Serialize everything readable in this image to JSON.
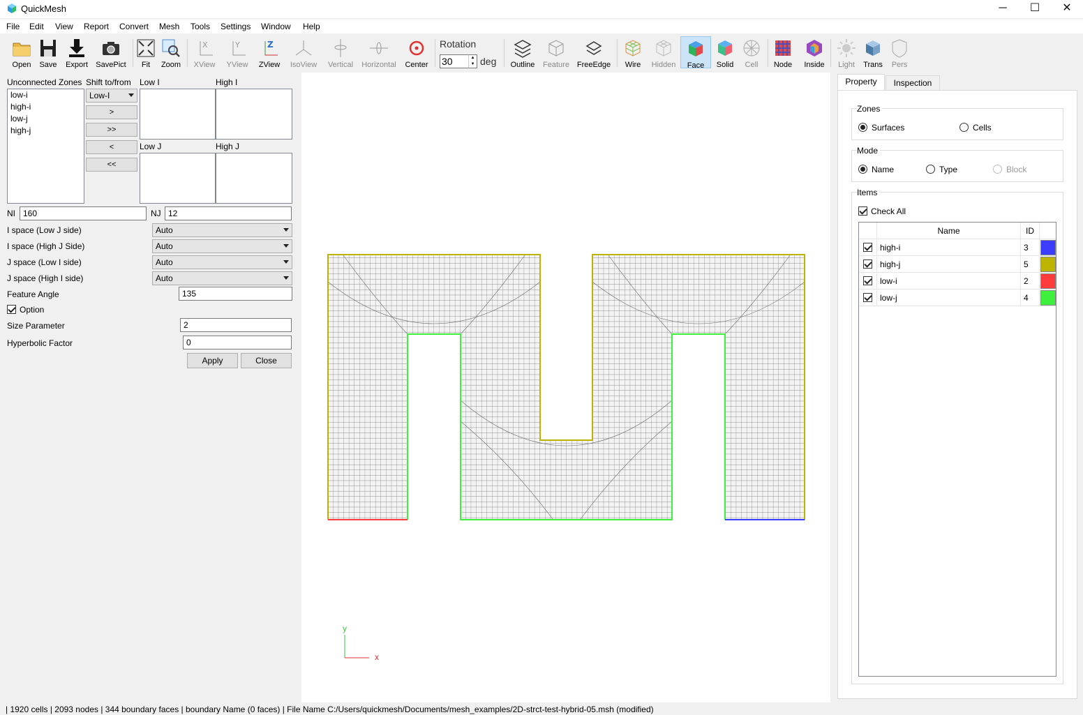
{
  "window": {
    "title": "QuickMesh",
    "minimize": "─",
    "maximize": "☐",
    "close": "✕"
  },
  "menu": [
    "File",
    "Edit",
    "View",
    "Report",
    "Convert",
    "Mesh",
    "Tools",
    "Settings",
    "Window",
    "Help"
  ],
  "toolbar": {
    "open": "Open",
    "save": "Save",
    "export": "Export",
    "savepict": "SavePict",
    "fit": "Fit",
    "zoom": "Zoom",
    "xview": "XView",
    "yview": "YView",
    "zview": "ZView",
    "isoview": "IsoView",
    "vertical": "Vertical",
    "horizontal": "Horizontal",
    "center": "Center",
    "rotation_label": "Rotation",
    "rotation_value": "30",
    "deg": "deg",
    "outline": "Outline",
    "feature": "Feature",
    "freeedge": "FreeEdge",
    "wire": "Wire",
    "hidden": "Hidden",
    "face": "Face",
    "solid": "Solid",
    "cell": "Cell",
    "node": "Node",
    "inside": "Inside",
    "light": "Light",
    "trans": "Trans",
    "pers": "Pers"
  },
  "left": {
    "unconnected_label": "Unconnected Zones",
    "shift_label": "Shift to/from",
    "zones": [
      "low-i",
      "high-i",
      "low-j",
      "high-j"
    ],
    "shift_value": "Low-I",
    "btn_one": ">",
    "btn_all": ">>",
    "btn_back_one": "<",
    "btn_back_all": "<<",
    "low_i": "Low I",
    "high_i": "High I",
    "low_j": "Low J",
    "high_j": "High J",
    "ni_label": "NI",
    "ni_value": "160",
    "nj_label": "NJ",
    "nj_value": "12",
    "ispace_low_label": "I space (Low J side)",
    "ispace_low_value": "Auto",
    "ispace_high_label": "I space (High J Side)",
    "ispace_high_value": "Auto",
    "jspace_low_label": "J space (Low I side)",
    "jspace_low_value": "Auto",
    "jspace_high_label": "J space (High I side)",
    "jspace_high_value": "Auto",
    "feature_angle_label": "Feature Angle",
    "feature_angle_value": "135",
    "option_label": "Option",
    "size_param_label": "Size Parameter",
    "size_param_value": "2",
    "hyperbolic_label": "Hyperbolic Factor",
    "hyperbolic_value": "0",
    "apply": "Apply",
    "close": "Close"
  },
  "viewport": {
    "axis_y": "y",
    "axis_x": "x"
  },
  "right": {
    "tab_property": "Property",
    "tab_inspection": "Inspection",
    "zones_title": "Zones",
    "surfaces": "Surfaces",
    "cells": "Cells",
    "mode_title": "Mode",
    "name": "Name",
    "type": "Type",
    "block": "Block",
    "items_title": "Items",
    "check_all": "Check All",
    "col_name": "Name",
    "col_id": "ID",
    "rows": [
      {
        "name": "high-i",
        "id": "3",
        "color": "#3c3cff"
      },
      {
        "name": "high-j",
        "id": "5",
        "color": "#bdb400"
      },
      {
        "name": "low-i",
        "id": "2",
        "color": "#ff3c3c"
      },
      {
        "name": "low-j",
        "id": "4",
        "color": "#3cf03c"
      }
    ]
  },
  "status": "| 1920 cells | 2093 nodes | 344 boundary faces |  boundary Name  (0 faces) | File Name C:/Users/quickmesh/Documents/mesh_examples/2D-strct-test-hybrid-05.msh (modified)",
  "colors": {
    "high_i": "#3c3cff",
    "high_j": "#bdb400",
    "low_i": "#ff3c3c",
    "low_j": "#3cf03c",
    "mesh_line": "#555555",
    "mesh_fill": "#f2f2f2"
  }
}
